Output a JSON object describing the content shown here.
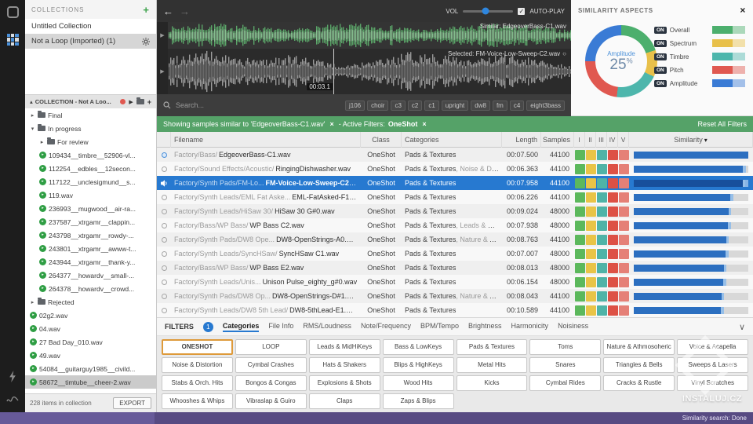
{
  "statusbar": {
    "text": "Similarity search: Done"
  },
  "watermark": "INSTALUJ.CZ",
  "collections": {
    "header": "COLLECTIONS",
    "add_label": "+",
    "items": [
      {
        "label": "Untitled Collection",
        "selected": false,
        "gear": false
      },
      {
        "label": "Not a Loop (Imported) (1)",
        "selected": true,
        "gear": true
      }
    ],
    "tree_header": "COLLECTION - Not A Loo...",
    "tree": [
      {
        "type": "folder",
        "label": "Final",
        "indent": 0,
        "expanded": false
      },
      {
        "type": "folder",
        "label": "In progress",
        "indent": 0,
        "expanded": true
      },
      {
        "type": "folder",
        "label": "For review",
        "indent": 1,
        "expanded": false
      },
      {
        "type": "file",
        "label": "109434__timbre__52906-vl...",
        "indent": 1
      },
      {
        "type": "file",
        "label": "112254__edbles__12secon...",
        "indent": 1
      },
      {
        "type": "file",
        "label": "117122__unclesigmund__s...",
        "indent": 1
      },
      {
        "type": "file",
        "label": "119.wav",
        "indent": 1
      },
      {
        "type": "file",
        "label": "236993__mugwood__air-ra...",
        "indent": 1
      },
      {
        "type": "file",
        "label": "237587__xtrgamr__clappin...",
        "indent": 1
      },
      {
        "type": "file",
        "label": "243798__xtrgamr__rowdy-...",
        "indent": 1
      },
      {
        "type": "file",
        "label": "243801__xtrgamr__awww-t...",
        "indent": 1
      },
      {
        "type": "file",
        "label": "243944__xtrgamr__thank-y...",
        "indent": 1
      },
      {
        "type": "file",
        "label": "264377__howardv__small-...",
        "indent": 1
      },
      {
        "type": "file",
        "label": "264378__howardv__crowd...",
        "indent": 1
      },
      {
        "type": "folder",
        "label": "Rejected",
        "indent": 0,
        "expanded": false
      },
      {
        "type": "file",
        "label": "02g2.wav",
        "indent": 0
      },
      {
        "type": "file",
        "label": "04.wav",
        "indent": 0
      },
      {
        "type": "file",
        "label": "27 Bad Day_010.wav",
        "indent": 0
      },
      {
        "type": "file",
        "label": "49.wav",
        "indent": 0
      },
      {
        "type": "file",
        "label": "54084__guitarguy1985__civild...",
        "indent": 0
      },
      {
        "type": "file",
        "label": "58672__timtube__cheer-2.wav",
        "indent": 0,
        "selected": true
      }
    ],
    "footer_count": "228 items in collection",
    "export_label": "EXPORT"
  },
  "player": {
    "vol_label": "VOL",
    "vol_percent": 45,
    "autoplay_label": "AUTO-PLAY",
    "autoplay_checked": "✓",
    "similar_label": "Similar: EdgeoverBass-C1.wav",
    "selected_label": "Selected: FM-Voice-Low-Sweep-C2.wav",
    "playhead_time": "00:03.1",
    "playhead_percent": 41
  },
  "search": {
    "placeholder": "Search...",
    "tags": [
      "j106",
      "choir",
      "c3",
      "c2",
      "c1",
      "upright",
      "dw8",
      "fm",
      "c4",
      "eight3bass"
    ]
  },
  "banner": {
    "text": "Showing samples similar to 'EdgeoverBass-C1.wav'",
    "filters_label": "- Active Filters:",
    "filter_value": "OneShot",
    "reset_label": "Reset All Filters"
  },
  "table": {
    "columns": [
      "Filename",
      "Class",
      "Categories",
      "Length",
      "Samples",
      "I",
      "II",
      "III",
      "IV",
      "V",
      "Similarity"
    ],
    "swatches": [
      "#5cb85c",
      "#e9c447",
      "#4fb3a7",
      "#dd5145",
      "#e58077"
    ],
    "rows": [
      {
        "path": "Factory/Bass/",
        "name": "EdgeoverBass-C1.wav",
        "cls": "OneShot",
        "cat": "Pads & Textures",
        "cat2": "",
        "length": "00:07.500",
        "samples": "44100",
        "sim": 100,
        "tail": 0,
        "icon": "ref",
        "selected": false
      },
      {
        "path": "Factory/Sound Effects/Acoustic/",
        "name": "RingingDishwasher.wav",
        "cls": "OneShot",
        "cat": "Pads & Textures",
        "cat2": "Noise & Disto...",
        "length": "00:06.363",
        "samples": "44100",
        "sim": 95,
        "tail": 3,
        "icon": "circle",
        "selected": false
      },
      {
        "path": "Factory/Synth Pads/FM-Lo...",
        "name": "FM-Voice-Low-Sweep-C2.wav",
        "cls": "OneShot",
        "cat": "Pads & Textures",
        "cat2": "",
        "length": "00:07.958",
        "samples": "44100",
        "sim": 95,
        "tail": 2,
        "icon": "speaker",
        "selected": true
      },
      {
        "path": "Factory/Synth Leads/EML Fat Aske...",
        "name": "EML-FatAsked-F1.wav",
        "cls": "OneShot",
        "cat": "Pads & Textures",
        "cat2": "",
        "length": "00:06.226",
        "samples": "44100",
        "sim": 84,
        "tail": 3,
        "icon": "circle",
        "selected": false
      },
      {
        "path": "Factory/Synth Leads/HiSaw 30/",
        "name": "HiSaw 30 G#0.wav",
        "cls": "OneShot",
        "cat": "Pads & Textures",
        "cat2": "",
        "length": "00:09.024",
        "samples": "48000",
        "sim": 83,
        "tail": 2,
        "icon": "circle",
        "selected": false
      },
      {
        "path": "Factory/Bass/WP Bass/",
        "name": "WP Bass C2.wav",
        "cls": "OneShot",
        "cat": "Pads & Textures",
        "cat2": "Leads & MidH...",
        "length": "00:07.938",
        "samples": "48000",
        "sim": 82,
        "tail": 3,
        "icon": "circle",
        "selected": false
      },
      {
        "path": "Factory/Synth Pads/DW8 Ope...",
        "name": "DW8-OpenStrings-A0.wav",
        "cls": "OneShot",
        "cat": "Pads & Textures",
        "cat2": "Nature & Ath...",
        "length": "00:08.763",
        "samples": "44100",
        "sim": 81,
        "tail": 2,
        "icon": "circle",
        "selected": false
      },
      {
        "path": "Factory/Synth Leads/SyncHSaw/",
        "name": "SyncHSaw C1.wav",
        "cls": "OneShot",
        "cat": "Pads & Textures",
        "cat2": "",
        "length": "00:07.007",
        "samples": "48000",
        "sim": 80,
        "tail": 3,
        "icon": "circle",
        "selected": false
      },
      {
        "path": "Factory/Bass/WP Bass/",
        "name": "WP Bass E2.wav",
        "cls": "OneShot",
        "cat": "Pads & Textures",
        "cat2": "",
        "length": "00:08.013",
        "samples": "48000",
        "sim": 79,
        "tail": 2,
        "icon": "circle",
        "selected": false
      },
      {
        "path": "Factory/Synth Leads/Unis...",
        "name": "Unison Pulse_eighty_g#0.wav",
        "cls": "OneShot",
        "cat": "Pads & Textures",
        "cat2": "",
        "length": "00:06.154",
        "samples": "48000",
        "sim": 78,
        "tail": 3,
        "icon": "circle",
        "selected": false
      },
      {
        "path": "Factory/Synth Pads/DW8 Op...",
        "name": "DW8-OpenStrings-D#1.wav",
        "cls": "OneShot",
        "cat": "Pads & Textures",
        "cat2": "Nature & Ath...",
        "length": "00:08.043",
        "samples": "44100",
        "sim": 77,
        "tail": 2,
        "icon": "circle",
        "selected": false
      },
      {
        "path": "Factory/Synth Leads/DW8 5th Lead/",
        "name": "DW8-5thLead-E1.wav",
        "cls": "OneShot",
        "cat": "Pads & Textures",
        "cat2": "",
        "length": "00:10.589",
        "samples": "44100",
        "sim": 76,
        "tail": 3,
        "icon": "circle",
        "selected": false
      }
    ]
  },
  "filters": {
    "label": "FILTERS",
    "badge": "1",
    "tabs": [
      {
        "label": "Categories",
        "active": true
      },
      {
        "label": "File Info",
        "active": false
      },
      {
        "label": "RMS/Loudness",
        "active": false
      },
      {
        "label": "Note/Frequency",
        "active": false
      },
      {
        "label": "BPM/Tempo",
        "active": false
      },
      {
        "label": "Brightness",
        "active": false
      },
      {
        "label": "Harmonicity",
        "active": false
      },
      {
        "label": "Noisiness",
        "active": false
      }
    ],
    "active_category": "ONESHOT",
    "categories": [
      "ONESHOT",
      "LOOP",
      "Leads & MidHiKeys",
      "Bass & LowKeys",
      "Pads & Textures",
      "Toms",
      "Nature & Athmosoheric",
      "Voice & Acapella",
      "Noise & Distortion",
      "Cymbal Crashes",
      "Hats & Shakers",
      "Blips & HighKeys",
      "Metal Hits",
      "Snares",
      "Triangles & Bells",
      "Sweeps & Lasers",
      "Stabs & Orch. Hits",
      "Bongos & Congas",
      "Explosions & Shots",
      "Wood Hits",
      "Kicks",
      "Cymbal Rides",
      "Cracks & Rustle",
      "Vinyl Scratches",
      "Whooshes & Whips",
      "Vibraslap & Guiro",
      "Claps",
      "Zaps & Blips",
      "",
      "",
      "",
      ""
    ]
  },
  "similarity_panel": {
    "title": "SIMILARITY ASPECTS",
    "close": "×",
    "center_label": "Amplitude",
    "center_value": "25",
    "center_unit": "%",
    "donut": [
      {
        "color": "#4caf6d",
        "value": 20
      },
      {
        "color": "#e8c04a",
        "value": 12
      },
      {
        "color": "#4db6ac",
        "value": 20
      },
      {
        "color": "#e05850",
        "value": 23
      },
      {
        "color": "#3a7bd5",
        "value": 25
      }
    ],
    "aspects": [
      {
        "label": "Overall",
        "on": "ON",
        "color": "#4caf6d"
      },
      {
        "label": "Spectrum",
        "on": "ON",
        "color": "#e8c04a"
      },
      {
        "label": "Timbre",
        "on": "ON",
        "color": "#4db6ac"
      },
      {
        "label": "Pitch",
        "on": "ON",
        "color": "#e05850"
      },
      {
        "label": "Amplitude",
        "on": "ON",
        "color": "#3a7bd5"
      }
    ]
  }
}
